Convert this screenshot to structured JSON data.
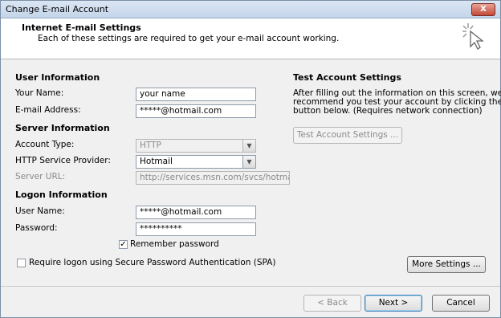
{
  "window": {
    "title": "Change E-mail Account",
    "close_label": "X"
  },
  "header": {
    "title": "Internet E-mail Settings",
    "subtitle": "Each of these settings are required to get your e-mail account working."
  },
  "user_info": {
    "heading": "User Information",
    "name_label": "Your Name:",
    "name_value": "your name",
    "email_label": "E-mail Address:",
    "email_value": "*****@hotmail.com"
  },
  "server_info": {
    "heading": "Server Information",
    "account_type_label": "Account Type:",
    "account_type_value": "HTTP",
    "provider_label": "HTTP Service Provider:",
    "provider_value": "Hotmail",
    "server_url_label": "Server URL:",
    "server_url_value": "http://services.msn.com/svcs/hotmail/h"
  },
  "logon_info": {
    "heading": "Logon Information",
    "username_label": "User Name:",
    "username_value": "*****@hotmail.com",
    "password_label": "Password:",
    "password_value": "**********",
    "remember_label": "Remember password",
    "remember_checked": true,
    "spa_label": "Require logon using Secure Password Authentication (SPA)",
    "spa_checked": false
  },
  "test_settings": {
    "heading": "Test Account Settings",
    "description_1": "After filling out the information on this screen, we",
    "description_2": "recommend you test your account by clicking the",
    "description_3": "button below. (Requires network connection)",
    "test_button": "Test Account Settings ..."
  },
  "more_settings_button": "More Settings ...",
  "footer": {
    "back_button": "< Back",
    "next_button": "Next >",
    "cancel_button": "Cancel"
  }
}
